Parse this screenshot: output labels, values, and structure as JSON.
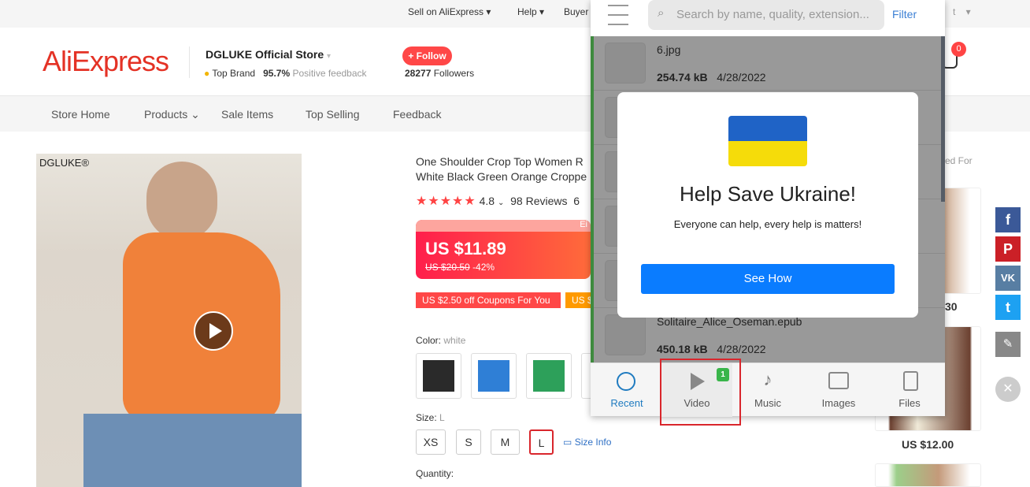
{
  "topbar": {
    "sell": "Sell on AliExpress",
    "help": "Help",
    "buyer": "Buyer",
    "partial": "t"
  },
  "header": {
    "logo": "AliExpress",
    "store_name": "DGLUKE Official Store",
    "badge": "Top Brand",
    "feedback_pct": "95.7%",
    "feedback_label": "Positive feedback",
    "follow": "+ Follow",
    "followers_count": "28277",
    "followers_label": "Followers",
    "cart_count": "0"
  },
  "nav": [
    "Store Home",
    "Products",
    "Sale Items",
    "Top Selling",
    "Feedback"
  ],
  "product": {
    "photo_brand": "DGLUKE®",
    "title_line1": "One Shoulder Crop Top Women R",
    "title_line2": "White Black Green Orange Croppe",
    "rating": "4.8",
    "reviews": "98 Reviews",
    "orders_partial": "6",
    "banner_partial": "Ei",
    "price": "US $11.89",
    "old_price": "US $20.50",
    "discount": "-42%",
    "coupon1": "US $2.50 off Coupons For You",
    "coupon2": "US $",
    "color_label": "Color:",
    "color_value": "white",
    "swatch_colors": [
      "#2a2a2a",
      "#2f7fd6",
      "#2da05a"
    ],
    "size_label": "Size:",
    "size_value": "L",
    "sizes": [
      "XS",
      "S",
      "M",
      "L"
    ],
    "size_info": "Size Info",
    "quantity_label": "Quantity:"
  },
  "recommend": {
    "title_partial": "ed For",
    "price1_partial": "30",
    "price2": "US $12.00"
  },
  "panel": {
    "search_placeholder": "Search by name, quality, extension...",
    "filter": "Filter",
    "files": [
      {
        "name": "6.jpg",
        "size": "254.74 kB",
        "date": "4/28/2022"
      },
      {
        "name": "Solitaire_Alice_Oseman.epub",
        "size": "450.18 kB",
        "date": "4/28/2022"
      }
    ],
    "tabs": [
      {
        "label": "Recent",
        "icon": "clock-icon"
      },
      {
        "label": "Video",
        "icon": "play-icon",
        "badge": "1"
      },
      {
        "label": "Music",
        "icon": "music-note-icon"
      },
      {
        "label": "Images",
        "icon": "image-icon"
      },
      {
        "label": "Files",
        "icon": "file-icon"
      }
    ]
  },
  "modal": {
    "title": "Help Save Ukraine!",
    "subtitle": "Everyone can help, every help is matters!",
    "button": "See How"
  },
  "colors": {
    "accent": "#e43225",
    "follow": "#ff4747",
    "modal_button": "#0a7cff",
    "badge_green": "#39b54a",
    "highlight": "#d9262c"
  }
}
